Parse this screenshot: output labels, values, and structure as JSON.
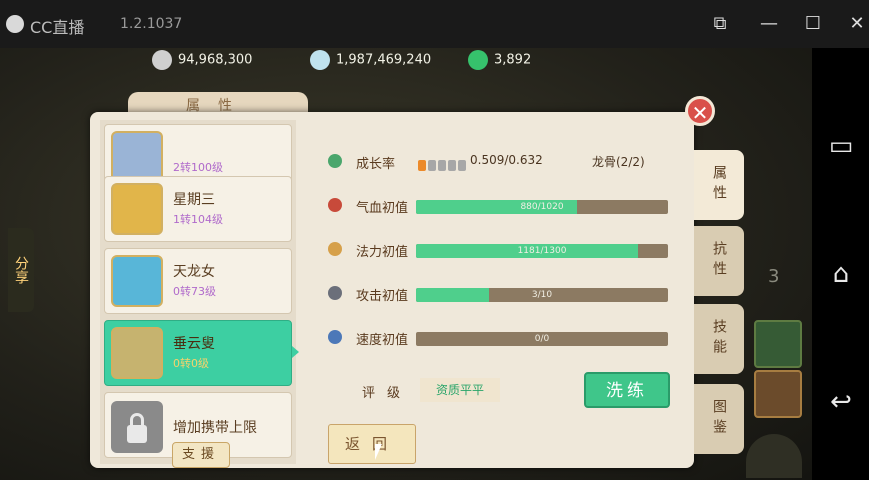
{
  "window": {
    "title": "CC直播",
    "version": "1.2.1037"
  },
  "currency": {
    "coins": "94,968,300",
    "silver": "1,987,469,240",
    "jade": "3,892"
  },
  "panel": {
    "tab_title": "属性",
    "close_label": "✕"
  },
  "pets": [
    {
      "name": "",
      "level": "2转100级",
      "avatar_color": "#9ab4d6"
    },
    {
      "name": "星期三",
      "level": "1转104级",
      "avatar_color": "#e1b54a"
    },
    {
      "name": "天龙女",
      "level": "0转73级",
      "avatar_color": "#58b6d8"
    },
    {
      "name": "垂云叟",
      "level": "0转0级",
      "avatar_color": "#c6b36f",
      "selected": true
    },
    {
      "name": "增加携带上限",
      "level": "",
      "locked": true
    }
  ],
  "support_label": "支援",
  "stats": {
    "growth": {
      "label": "成长率",
      "value": "0.509/0.632"
    },
    "dragon_bone": "龙骨(2/2)",
    "rows": [
      {
        "label": "气血初值",
        "text": "880/1020",
        "fill": 0.64,
        "icon_color": "#c84a3a"
      },
      {
        "label": "法力初值",
        "text": "1181/1300",
        "fill": 0.88,
        "icon_color": "#d6a04a"
      },
      {
        "label": "攻击初值",
        "text": "3/10",
        "fill": 0.29,
        "icon_color": "#6b6f7a"
      },
      {
        "label": "速度初值",
        "text": "0/0",
        "fill": 0.0,
        "icon_color": "#4c78b8"
      }
    ],
    "grade_label": "评级",
    "grade_value": "资质平平",
    "wash_label": "洗练"
  },
  "back_label": "返回",
  "side_tabs": [
    "属性",
    "抗性",
    "技能",
    "图鉴"
  ],
  "share_label": "分享",
  "bg_number": "3"
}
